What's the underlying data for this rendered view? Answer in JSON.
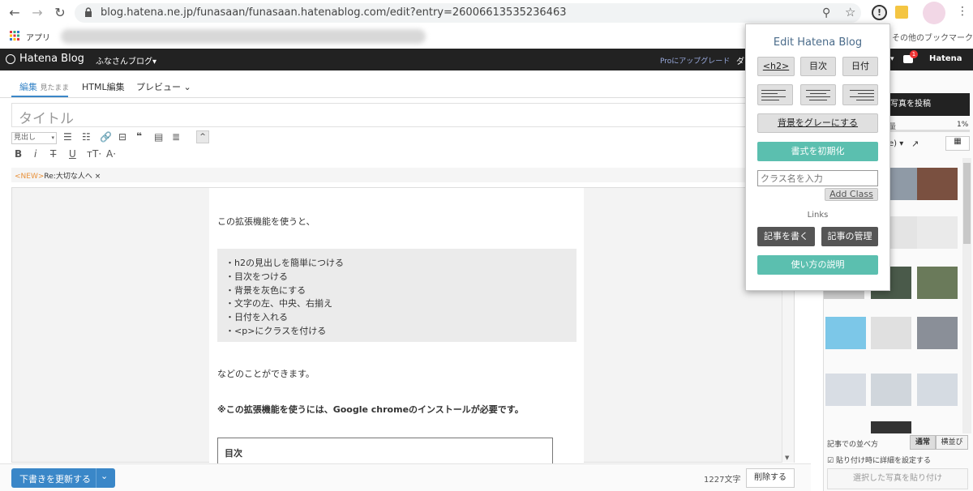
{
  "browser": {
    "url": "blog.hatena.ne.jp/funasaan/funasaan.hatenablog.com/edit?entry=26006613535236463",
    "apps_label": "アプリ",
    "other_bookmarks": "その他のブックマーク"
  },
  "hatena_bar": {
    "logo": "Hatena Blog",
    "blog_name": "ふなさんブログ▾",
    "pro_upgrade": "Proにアップグレード",
    "dash_label": "ダ",
    "notification_count": "1",
    "hatena_label": "Hatena"
  },
  "editor": {
    "tabs": [
      {
        "label": "編集",
        "sub": "見たまま"
      },
      {
        "label": "HTML編集"
      },
      {
        "label": "プレビュー"
      }
    ],
    "title_placeholder": "タイトル",
    "heading_select": "見出し",
    "tag_prefix": "<NEW>",
    "tag_label": "Re:大切な人へ",
    "body": {
      "intro": "この拡張機能を使うと、",
      "list": [
        "・h2の見出しを簡単につける",
        "・目次をつける",
        "・背景を灰色にする",
        "・文字の左、中央、右揃え",
        "・日付を入れる",
        "・<p>にクラスを付ける"
      ],
      "after": "などのことができます。",
      "notice": "※この拡張機能を使うには、Google chromeのインストールが必要です。",
      "toc_title": "目次"
    }
  },
  "footer": {
    "save_label": "下書きを更新する",
    "char_count": "1227文字",
    "delete_label": "削除する"
  },
  "sidebar": {
    "post_photo": "写真を投稿",
    "storage_label": "量",
    "storage_pct": "1%",
    "filter_suffix": "e) ▾",
    "order_label": "記事での並べ方",
    "order_normal": "通常",
    "order_side": "横並び",
    "paste_detail": "貼り付け時に詳細を設定する",
    "paste_btn": "選択した写真を貼り付け"
  },
  "popup": {
    "title": "Edit Hatena Blog",
    "h2_btn": "<h2>",
    "toc_btn": "目次",
    "date_btn": "日付",
    "gray_btn": "背景をグレーにする",
    "reset_btn": "書式を初期化",
    "class_placeholder": "クラス名を入力",
    "add_class": "Add Class",
    "links_label": "Links",
    "write_btn": "記事を書く",
    "manage_btn": "記事の管理",
    "howto_btn": "使い方の説明",
    "accent": "#5bbfaf"
  }
}
